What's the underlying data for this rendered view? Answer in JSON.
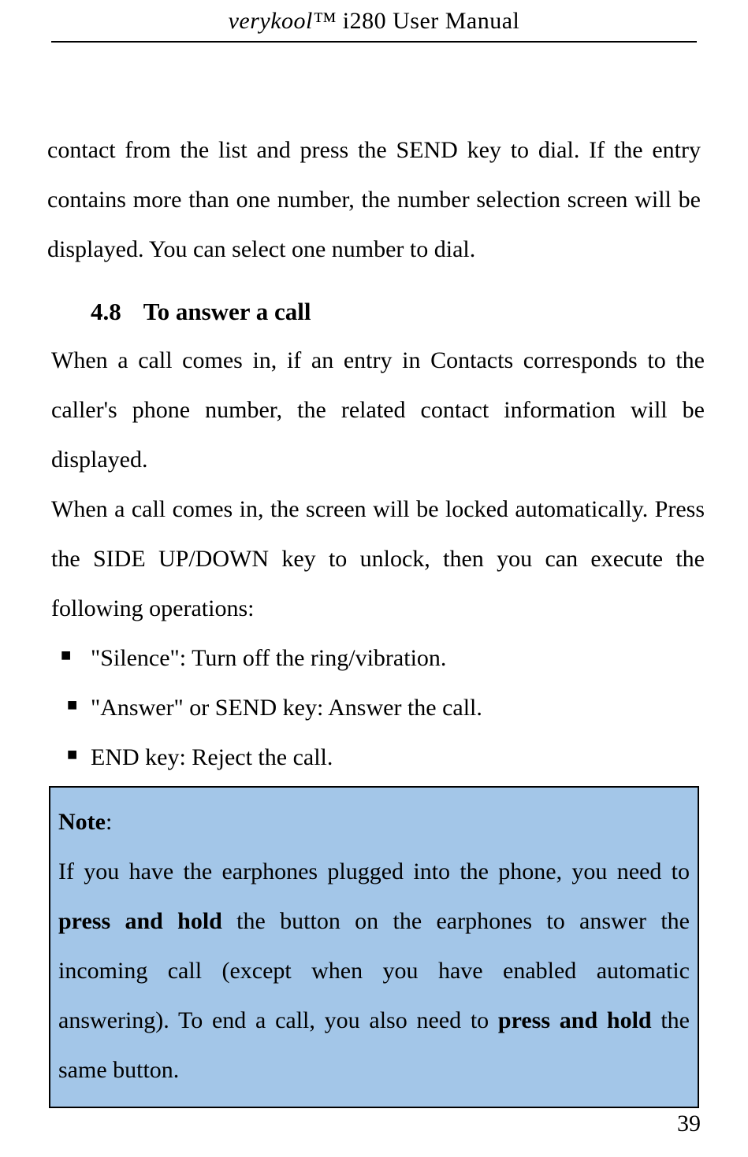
{
  "header": {
    "brand": "verykool™",
    "product": " i280 User Manual"
  },
  "para1": "contact from the list and press the SEND key to dial. If the entry contains more than one number, the number selection screen will be displayed. You can select one number to dial.",
  "section": {
    "number": "4.8",
    "title": "To answer a call"
  },
  "para2": "When a call comes in, if an entry in Contacts corresponds to the caller's phone number, the related contact information will be displayed.",
  "para3": "When a call comes in, the screen will be locked automatically. Press the SIDE UP/DOWN key to unlock, then you can execute the following operations:",
  "bullets": [
    " \"Silence\": Turn off the ring/vibration.",
    "\"Answer\" or SEND key: Answer the call.",
    "END key: Reject the call."
  ],
  "note": {
    "label": "Note",
    "colon": ":",
    "text_pre": "If you have the earphones plugged into the phone, you need to ",
    "bold1": "press and hold",
    "text_mid": " the button on the earphones to answer the incoming call (except when you have enabled automatic answering). To end a call, you also need to ",
    "bold2": "press and hold",
    "text_end": " the same button."
  },
  "page_number": "39"
}
